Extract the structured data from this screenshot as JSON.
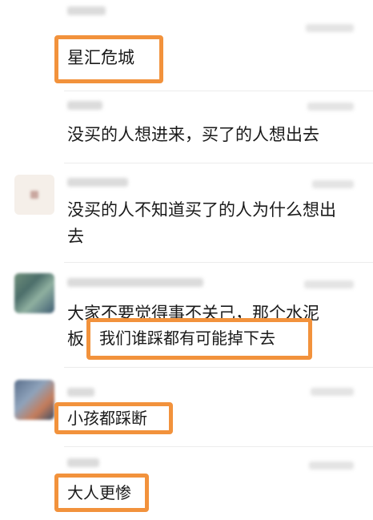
{
  "comments": [
    {
      "text": "星汇危城"
    },
    {
      "text": "没买的人想进来，买了的人想出去"
    },
    {
      "line1": "没买的人不知道买了的人为什么想出",
      "line2": "去"
    },
    {
      "line1": "大家不要觉得事不关己，那个水泥",
      "line2_prefix": "板",
      "line2_highlight": "我们谁踩都有可能掉下去"
    },
    {
      "text": "小孩都踩断"
    },
    {
      "text": "大人更惨"
    }
  ],
  "colors": {
    "highlight": "#f2923c",
    "background": "#ffffff",
    "text": "#1a1a1a"
  }
}
